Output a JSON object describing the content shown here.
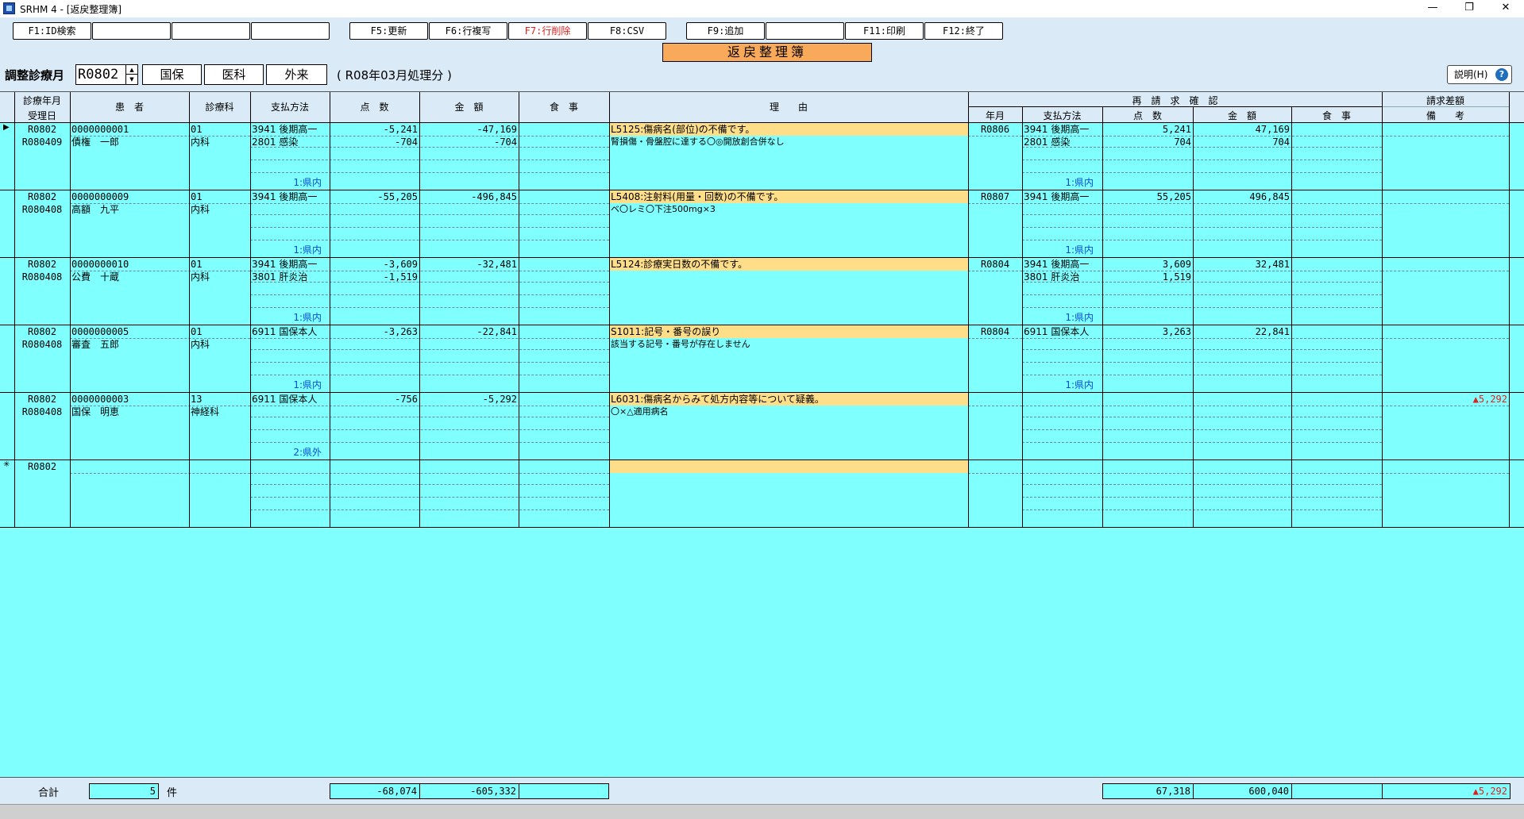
{
  "window": {
    "title": "SRHM 4 - [返戻整理簿]",
    "minimize": "—",
    "restore": "❐",
    "close": "✕"
  },
  "fkeys": [
    {
      "label": "F1:ID検索"
    },
    {
      "label": ""
    },
    {
      "label": ""
    },
    {
      "label": ""
    },
    {
      "label": "F5:更新"
    },
    {
      "label": "F6:行複写"
    },
    {
      "label": "F7:行削除"
    },
    {
      "label": "F8:CSV"
    },
    {
      "label": "F9:追加"
    },
    {
      "label": ""
    },
    {
      "label": "F11:印刷"
    },
    {
      "label": "F12:終了"
    }
  ],
  "form_title": "返戻整理簿",
  "filter": {
    "month_label": "調整診療月",
    "month_value": "R0802",
    "btn_kokuho": "国保",
    "btn_ika": "医科",
    "btn_gairai": "外来",
    "period": "( R08年03月処理分 )",
    "help": "説明(H)",
    "help_q": "?"
  },
  "header": {
    "shinryo": "診療年月",
    "uketsuke": "受理日",
    "kanja": "患　者",
    "ka": "診療科",
    "shiharai": "支払方法",
    "tensu": "点　数",
    "kingaku": "金　額",
    "shokuji": "食　事",
    "riyu": "理　　由",
    "saiseikyu": "再　請　求　確　認",
    "ym": "年月",
    "shiharai2": "支払方法",
    "tensu2": "点　数",
    "kingaku2": "金　額",
    "shokuji2": "食　事",
    "sagaku": "請求差額",
    "biko": "備　　考"
  },
  "rows": [
    {
      "marker": "▶",
      "month": "R0802",
      "recv": "R080409",
      "pid": "0000000001",
      "name": "債権　一郎",
      "ka_code": "01",
      "ka": "内科",
      "pay1": "3941 後期高一",
      "pay2": "2801 感染",
      "pref": "1:県内",
      "pts1": "-5,241",
      "pts2": "-704",
      "amt1": "-47,169",
      "amt2": "-704",
      "reason": "L5125:傷病名(部位)の不備です。",
      "note": "腎損傷・骨盤腔に達する〇◎開放創合併なし",
      "r_ym": "R0806",
      "r_pay1": "3941 後期高一",
      "r_pay2": "2801 感染",
      "r_pref": "1:県内",
      "r_pts1": "5,241",
      "r_pts2": "704",
      "r_amt1": "47,169",
      "r_amt2": "704",
      "diff": ""
    },
    {
      "marker": "",
      "month": "R0802",
      "recv": "R080408",
      "pid": "0000000009",
      "name": "高額　九平",
      "ka_code": "01",
      "ka": "内科",
      "pay1": "3941 後期高一",
      "pay2": "",
      "pref": "1:県内",
      "pts1": "-55,205",
      "pts2": "",
      "amt1": "-496,845",
      "amt2": "",
      "reason": "L5408:注射料(用量・回数)の不備です。",
      "note": "ベ〇レミ〇下注500mg×3",
      "r_ym": "R0807",
      "r_pay1": "3941 後期高一",
      "r_pay2": "",
      "r_pref": "1:県内",
      "r_pts1": "55,205",
      "r_pts2": "",
      "r_amt1": "496,845",
      "r_amt2": "",
      "diff": ""
    },
    {
      "marker": "",
      "month": "R0802",
      "recv": "R080408",
      "pid": "0000000010",
      "name": "公費　十蔵",
      "ka_code": "01",
      "ka": "内科",
      "pay1": "3941 後期高一",
      "pay2": "3801 肝炎治",
      "pref": "1:県内",
      "pts1": "-3,609",
      "pts2": "-1,519",
      "amt1": "-32,481",
      "amt2": "",
      "reason": "L5124:診療実日数の不備です。",
      "note": "",
      "r_ym": "R0804",
      "r_pay1": "3941 後期高一",
      "r_pay2": "3801 肝炎治",
      "r_pref": "1:県内",
      "r_pts1": "3,609",
      "r_pts2": "1,519",
      "r_amt1": "32,481",
      "r_amt2": "",
      "diff": ""
    },
    {
      "marker": "",
      "month": "R0802",
      "recv": "R080408",
      "pid": "0000000005",
      "name": "審査　五郎",
      "ka_code": "01",
      "ka": "内科",
      "pay1": "6911 国保本人",
      "pay2": "",
      "pref": "1:県内",
      "pts1": "-3,263",
      "pts2": "",
      "amt1": "-22,841",
      "amt2": "",
      "reason": "S1011:記号・番号の誤り",
      "note": "該当する記号・番号が存在しません",
      "r_ym": "R0804",
      "r_pay1": "6911 国保本人",
      "r_pay2": "",
      "r_pref": "1:県内",
      "r_pts1": "3,263",
      "r_pts2": "",
      "r_amt1": "22,841",
      "r_amt2": "",
      "diff": ""
    },
    {
      "marker": "",
      "month": "R0802",
      "recv": "R080408",
      "pid": "0000000003",
      "name": "国保　明恵",
      "ka_code": "13",
      "ka": "神経科",
      "pay1": "6911 国保本人",
      "pay2": "",
      "pref": "2:県外",
      "pts1": "-756",
      "pts2": "",
      "amt1": "-5,292",
      "amt2": "",
      "reason": "L6031:傷病名からみて処方内容等について疑義。",
      "note": "〇×△適用病名",
      "r_ym": "",
      "r_pay1": "",
      "r_pay2": "",
      "r_pref": "",
      "r_pts1": "",
      "r_pts2": "",
      "r_amt1": "",
      "r_amt2": "",
      "diff": "▲5,292"
    },
    {
      "marker": "✳",
      "month": "R0802",
      "recv": "",
      "pid": "",
      "name": "",
      "ka_code": "",
      "ka": "",
      "pay1": "",
      "pay2": "",
      "pref": "",
      "pts1": "",
      "pts2": "",
      "amt1": "",
      "amt2": "",
      "reason": "",
      "note": "",
      "r_ym": "",
      "r_pay1": "",
      "r_pay2": "",
      "r_pref": "",
      "r_pts1": "",
      "r_pts2": "",
      "r_amt1": "",
      "r_amt2": "",
      "diff": ""
    }
  ],
  "footer": {
    "total_label": "合計",
    "count": "5",
    "count_unit": "件",
    "tensu": "-68,074",
    "kingaku": "-605,332",
    "shokuji": "",
    "r_tensu": "67,318",
    "r_kingaku": "600,040",
    "r_shokuji": "",
    "diff": "▲5,292"
  },
  "colors": {
    "grid_bg": "#80ffff",
    "panel_bg": "#daeaf6",
    "reason_highlight": "#ffde8a",
    "title_bg": "#f9a95a",
    "negative_mark": "#e0201e",
    "pref_text": "#0a4fd0"
  }
}
